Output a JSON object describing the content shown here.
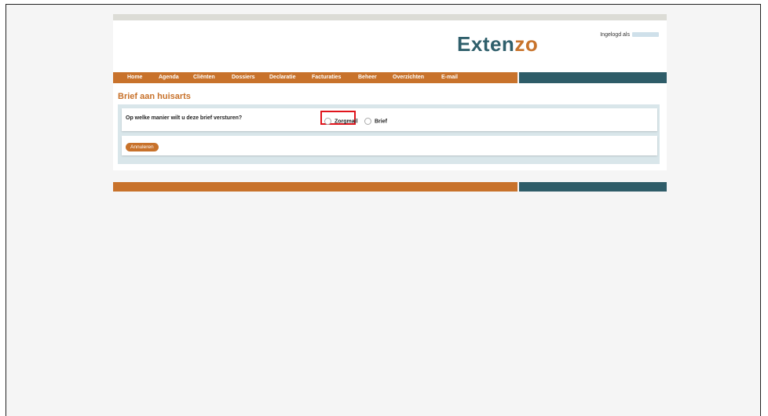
{
  "header": {
    "logo_part1": "Exten",
    "logo_part2": "zo",
    "login_label": "Ingelogd als"
  },
  "nav": {
    "items": [
      "Home",
      "Agenda",
      "Cliënten",
      "Dossiers",
      "Declaratie",
      "Facturaties",
      "Beheer",
      "Overzichten",
      "E-mail"
    ]
  },
  "page": {
    "title": "Brief aan huisarts",
    "question": "Op welke manier wilt u deze brief versturen?",
    "options": [
      "Zorgmail",
      "Brief"
    ],
    "cancel_label": "Annuleren"
  },
  "colors": {
    "brand_orange": "#c8722b",
    "brand_teal": "#2e5c68",
    "highlight_red": "#e0141c"
  }
}
